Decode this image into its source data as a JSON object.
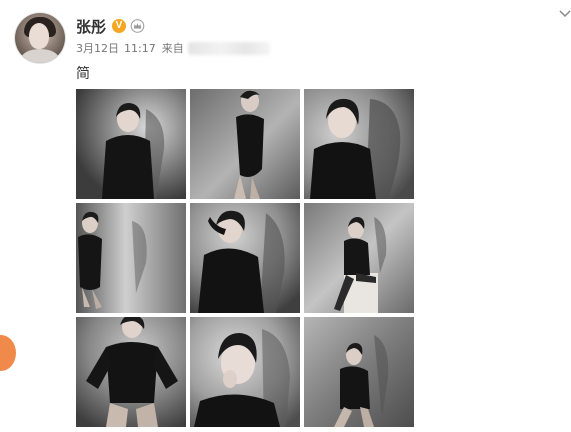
{
  "post": {
    "author_name": "张彤",
    "verified_badge": "V",
    "date": "3月12日",
    "time": "11:17",
    "source_prefix": "来自",
    "text": "简"
  },
  "icons": {
    "verified": "verified-badge-icon",
    "vip": "crown-icon",
    "menu": "chevron-down-icon"
  },
  "colors": {
    "verified_badge": "#f5a623",
    "side_bubble": "#f08a4b",
    "name_text": "#333333",
    "meta_text": "#777777"
  },
  "photos": [
    {
      "label": "photo-1"
    },
    {
      "label": "photo-2"
    },
    {
      "label": "photo-3"
    },
    {
      "label": "photo-4"
    },
    {
      "label": "photo-5"
    },
    {
      "label": "photo-6"
    },
    {
      "label": "photo-7"
    },
    {
      "label": "photo-8"
    },
    {
      "label": "photo-9"
    }
  ]
}
